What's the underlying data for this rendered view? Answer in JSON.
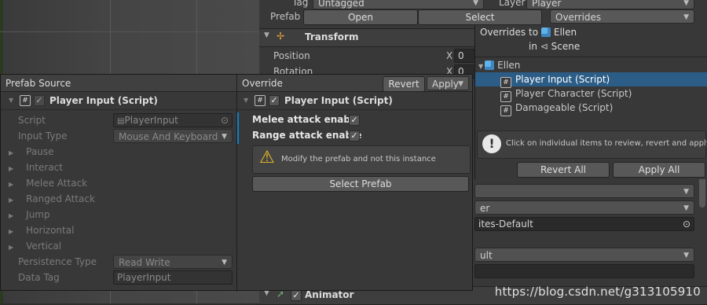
{
  "inspector": {
    "tag_label": "Tag",
    "tag_value": "Untagged",
    "layer_label": "Layer",
    "layer_value": "Player",
    "prefab_label": "Prefab",
    "open_label": "Open",
    "select_label": "Select",
    "overrides_label": "Overrides",
    "transform_title": "Transform",
    "position_label": "Position",
    "rotation_label": "Rotation",
    "x_label": "X",
    "pos_x": "0",
    "rot_x": "0",
    "behind_fields": [
      "er",
      "ites-Default",
      "ult"
    ],
    "animator_title": "Animator"
  },
  "overrides_popup": {
    "title_prefix": "Overrides to",
    "target": "Ellen",
    "in_label": "in",
    "scene_label": "Scene",
    "root": "Ellen",
    "items": [
      "Player Input (Script)",
      "Player Character (Script)",
      "Damageable (Script)"
    ],
    "selected_index": 0,
    "info_text": "Click on individual items to review, revert and apply.",
    "revert_all": "Revert All",
    "apply_all": "Apply All"
  },
  "prefab_source": {
    "header": "Prefab Source",
    "component": "Player Input (Script)",
    "script_label": "Script",
    "script_value": "PlayerInput",
    "input_type_label": "Input Type",
    "input_type_value": "Mouse And Keyboard",
    "foldouts": [
      "Pause",
      "Interact",
      "Melee Attack",
      "Ranged Attack",
      "Jump",
      "Horizontal",
      "Vertical"
    ],
    "persistence_label": "Persistence Type",
    "persistence_value": "Read Write",
    "data_tag_label": "Data Tag",
    "data_tag_value": "PlayerInput"
  },
  "override": {
    "header": "Override",
    "revert": "Revert",
    "apply": "Apply",
    "component": "Player Input (Script)",
    "melee_label": "Melee attack enable",
    "range_label": "Range attack enable",
    "warning": "Modify the prefab and not this instance",
    "select_prefab": "Select Prefab"
  },
  "watermark": "https://blog.csdn.net/g313105910",
  "colors": {
    "selection": "#2c5d87",
    "override_bar": "#0f81c9",
    "icon_blue": "#5fb3e8"
  }
}
